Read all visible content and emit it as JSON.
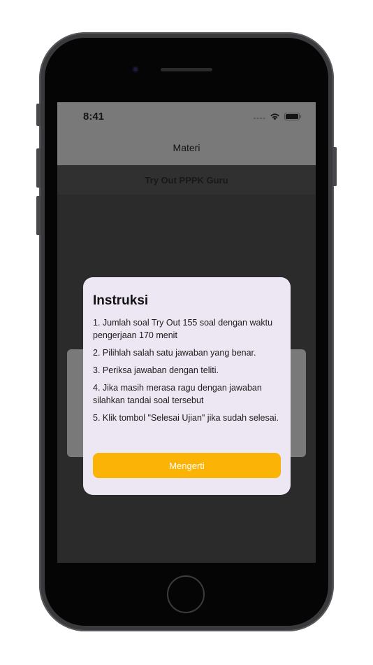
{
  "status_bar": {
    "time": "8:41"
  },
  "navbar": {
    "title": "Materi"
  },
  "subheader": {
    "title": "Try Out PPPK Guru"
  },
  "modal": {
    "title": "Instruksi",
    "items": [
      "1. Jumlah soal Try Out 155 soal dengan waktu pengerjaan 170 menit",
      "2. Pilihlah salah satu jawaban yang benar.",
      "3. Periksa jawaban dengan teliti.",
      "4. Jika masih merasa ragu dengan jawaban silahkan tandai soal tersebut",
      "5. Klik tombol \"Selesai Ujian\" jika sudah selesai."
    ],
    "confirm_label": "Mengerti"
  },
  "icons": {
    "cellular": "cellular-signal-icon",
    "wifi": "wifi-icon",
    "battery": "battery-icon"
  },
  "colors": {
    "accent": "#fbb305",
    "modal_background": "#ede7f3",
    "overlay_dark": "#2b2b2b",
    "navbar_dimmed": "#797979"
  }
}
